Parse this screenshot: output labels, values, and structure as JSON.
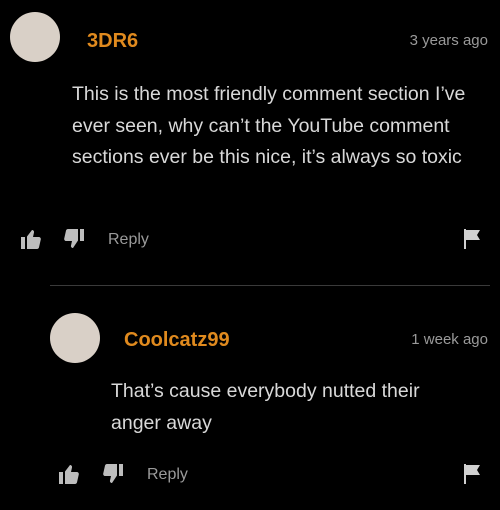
{
  "comments": [
    {
      "username": "3DR6",
      "timestamp": "3 years ago",
      "text": "This is the most friendly comment section I’ve ever seen, why can’t the YouTube comment sections ever be this nice, it’s always so toxic",
      "reply_label": "Reply"
    },
    {
      "username": "Coolcatz99",
      "timestamp": "1 week ago",
      "text": "That’s cause everybody nutted their anger away",
      "reply_label": "Reply"
    }
  ],
  "colors": {
    "background": "#000000",
    "username": "#e08a1e",
    "body_text": "#d9d9d9",
    "muted": "#9a9a9a",
    "avatar": "#d9d0c7"
  },
  "icons": [
    "thumbs-up-icon",
    "thumbs-down-icon",
    "flag-icon"
  ]
}
